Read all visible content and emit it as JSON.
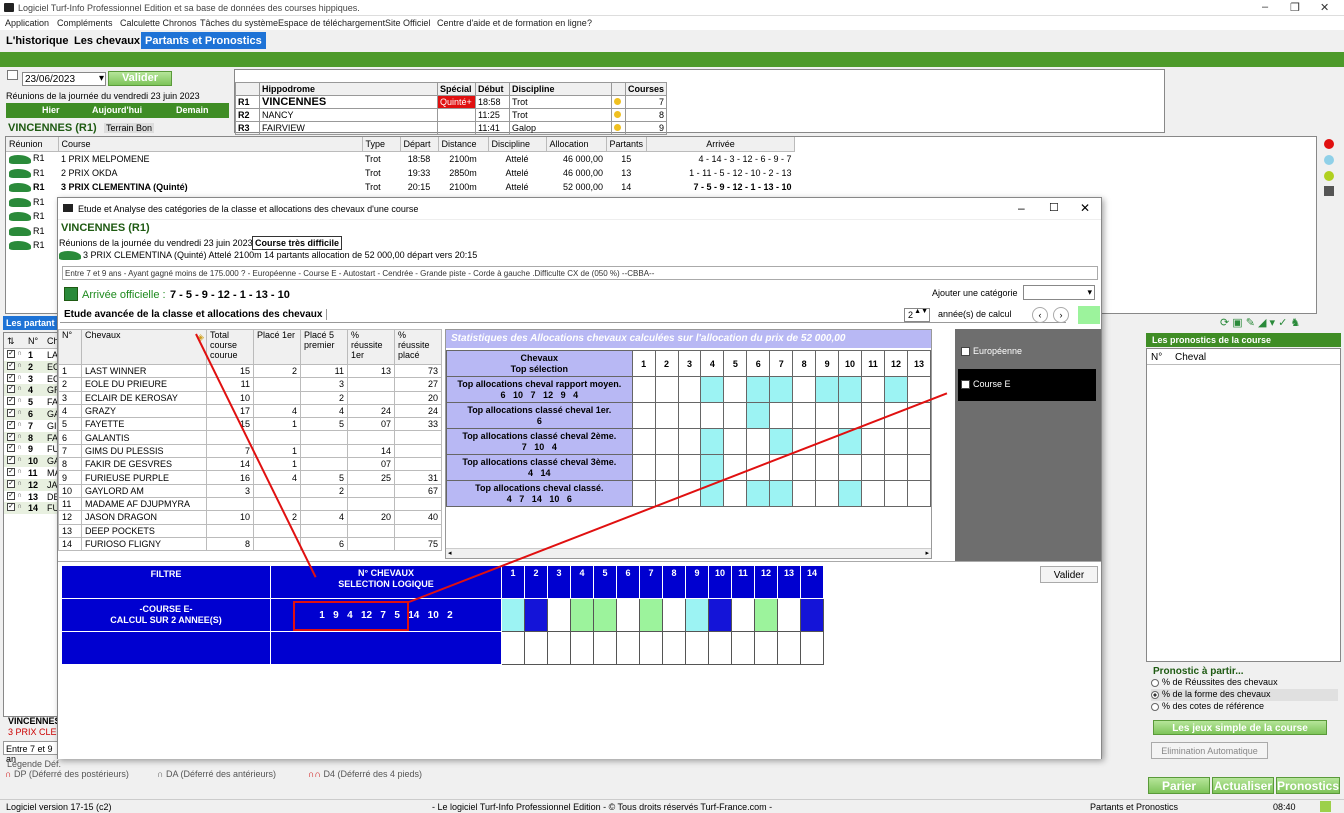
{
  "window": {
    "title": "Logiciel Turf-Info Professionnel Edition et sa base de données des courses hippiques."
  },
  "menu": [
    "Application",
    "Compléments",
    "Calculette Chronos",
    "Tâches du système",
    "Espace de téléchargement",
    "Site Officiel",
    "Centre d'aide et de formation en ligne",
    "?"
  ],
  "tabs": [
    "L'historique",
    "Les chevaux",
    "Partants et Pronostics"
  ],
  "date": {
    "value": "23/06/2023",
    "validate": "Valider",
    "reunions_label": "Réunions de la journée du vendredi 23 juin 2023",
    "hier": "Hier",
    "aujourdhui": "Aujourd'hui",
    "demain": "Demain"
  },
  "selected_reunion": {
    "name": "VINCENNES (R1)",
    "terrain": "Terrain Bon"
  },
  "hippodromes": {
    "headers": [
      "",
      "Hippodrome",
      "Spécial",
      "Début",
      "Discipline",
      "",
      "Courses"
    ],
    "rows": [
      {
        "r": "R1",
        "name": "VINCENNES",
        "special": "Quinté+",
        "debut": "18:58",
        "discipline": "Trot",
        "courses": "7"
      },
      {
        "r": "R2",
        "name": "NANCY",
        "special": "",
        "debut": "11:25",
        "discipline": "Trot",
        "courses": "8"
      },
      {
        "r": "R3",
        "name": "FAIRVIEW",
        "special": "",
        "debut": "11:41",
        "discipline": "Galop",
        "courses": "9"
      }
    ]
  },
  "races": {
    "headers": [
      "Réunion",
      "Course",
      "Type",
      "Départ",
      "Distance",
      "Discipline",
      "Allocation",
      "Partants",
      "Arrivée"
    ],
    "rows": [
      {
        "reunion": "R1",
        "course": "1 PRIX MELPOMENE",
        "type": "Trot",
        "depart": "18:58",
        "distance": "2100m",
        "discipline": "Attelé",
        "allocation": "46 000,00",
        "partants": "15",
        "arrivee": "4 - 14 - 3 - 12 - 6 - 9 - 7"
      },
      {
        "reunion": "R1",
        "course": "2 PRIX OKDA",
        "type": "Trot",
        "depart": "19:33",
        "distance": "2850m",
        "discipline": "Attelé",
        "allocation": "46 000,00",
        "partants": "13",
        "arrivee": "1 - 11 - 5 - 12 - 10 - 2 - 13"
      },
      {
        "reunion": "R1",
        "course": "3 PRIX CLEMENTINA (Quinté)",
        "type": "Trot",
        "depart": "20:15",
        "distance": "2100m",
        "discipline": "Attelé",
        "allocation": "52 000,00",
        "partants": "14",
        "arrivee": "7 - 5 - 9 - 12 - 1 - 13 - 10"
      },
      {
        "reunion": "R1"
      },
      {
        "reunion": "R1"
      },
      {
        "reunion": "R1"
      },
      {
        "reunion": "R1"
      }
    ]
  },
  "left_list": {
    "header_label": "Les partant",
    "cols": [
      "N°",
      "Ch"
    ],
    "rows": [
      {
        "n": "1",
        "c": "LA"
      },
      {
        "n": "2",
        "c": "EO"
      },
      {
        "n": "3",
        "c": "EC"
      },
      {
        "n": "4",
        "c": "GR"
      },
      {
        "n": "5",
        "c": "FA"
      },
      {
        "n": "6",
        "c": "GA"
      },
      {
        "n": "7",
        "c": "GI"
      },
      {
        "n": "8",
        "c": "FA"
      },
      {
        "n": "9",
        "c": "FU"
      },
      {
        "n": "10",
        "c": "GA"
      },
      {
        "n": "11",
        "c": "MA"
      },
      {
        "n": "12",
        "c": "JA"
      },
      {
        "n": "13",
        "c": "DE"
      },
      {
        "n": "14",
        "c": "FU"
      }
    ]
  },
  "bottom_left": {
    "reunion": "VINCENNES",
    "course": "3 PRIX CLEM",
    "cond": "Entre 7 et 9 an"
  },
  "legend": {
    "title": "Légende Déf.",
    "dp": "DP (Déferré des postérieurs)",
    "da": "DA (Déferré des antérieurs)",
    "d4": "D4 (Déferré des 4 pieds)"
  },
  "dialog": {
    "title": "Etude et Analyse des catégories de la classe et allocations des chevaux d'une course",
    "reunion": "VINCENNES (R1)",
    "reunions_label": "Réunions de la journée du vendredi 23 juin 2023",
    "difficulty": "Course très difficile",
    "race_line": "3 PRIX CLEMENTINA (Quinté) Attelé 2100m 14 partants allocation de 52 000,00 départ vers 20:15",
    "conditions": "Entre 7 et 9 ans  - Ayant gagné moins de 175.000 ? - Européenne  - Course E  - Autostart  - Cendrée  - Grande piste  - Corde à gauche .Difficulte CX de (050 %)  --CBBA--",
    "arrivee_label": "Arrivée officielle :",
    "arrivee_value": "7 - 5 - 9 - 12 - 1 - 13 - 10",
    "add_category": "Ajouter une catégorie",
    "section_title": "Etude avancée de la classe et allocations des chevaux",
    "years_value": "2",
    "years_label": "année(s) de calcul",
    "cat_headers": [
      "N°",
      "Chevaux",
      "Total course courue",
      "Placé 1er",
      "Placé 5 premier",
      "% réussite 1er",
      "% réussite placé"
    ],
    "cat_rows": [
      [
        "1",
        "LAST WINNER",
        "15",
        "2",
        "11",
        "13",
        "73"
      ],
      [
        "2",
        "EOLE DU PRIEURE",
        "11",
        "",
        "3",
        "",
        "27"
      ],
      [
        "3",
        "ECLAIR DE KEROSAY",
        "10",
        "",
        "2",
        "",
        "20"
      ],
      [
        "4",
        "GRAZY",
        "17",
        "4",
        "4",
        "24",
        "24"
      ],
      [
        "5",
        "FAYETTE",
        "15",
        "1",
        "5",
        "07",
        "33"
      ],
      [
        "6",
        "GALANTIS",
        "",
        "",
        "",
        "",
        ""
      ],
      [
        "7",
        "GIMS DU PLESSIS",
        "7",
        "1",
        "",
        "14",
        ""
      ],
      [
        "8",
        "FAKIR DE GESVRES",
        "14",
        "1",
        "",
        "07",
        ""
      ],
      [
        "9",
        "FURIEUSE PURPLE",
        "16",
        "4",
        "5",
        "25",
        "31"
      ],
      [
        "10",
        "GAYLORD AM",
        "3",
        "",
        "2",
        "",
        "67"
      ],
      [
        "11",
        "MADAME AF DJUPMYRA",
        "",
        "",
        "",
        "",
        ""
      ],
      [
        "12",
        "JASON DRAGON",
        "10",
        "2",
        "4",
        "20",
        "40"
      ],
      [
        "13",
        "DEEP POCKETS",
        "",
        "",
        "",
        "",
        ""
      ],
      [
        "14",
        "FURIOSO FLIGNY",
        "8",
        "",
        "6",
        "",
        "75"
      ]
    ],
    "stats_title": "Statistiques des Allocations chevaux calculées sur l'allocation du prix de 52 000,00",
    "stats_header": "Chevaux\nTop sélection",
    "stats_cols": [
      "1",
      "2",
      "3",
      "4",
      "5",
      "6",
      "7",
      "8",
      "9",
      "10",
      "11",
      "12",
      "13"
    ],
    "stats_rows": [
      {
        "label": "Top allocations cheval rapport moyen.",
        "values": "6   10   7   12   9   4",
        "cyan": [
          4,
          6,
          7,
          9,
          10,
          12
        ]
      },
      {
        "label": "Top allocations classé cheval 1er.",
        "values": "6",
        "cyan": [
          6
        ]
      },
      {
        "label": "Top allocations classé cheval 2ème.",
        "values": "7   10   4",
        "cyan": [
          4,
          7,
          10
        ]
      },
      {
        "label": "Top allocations classé cheval 3ème.",
        "values": "4   14",
        "cyan": [
          4
        ]
      },
      {
        "label": "Top allocations cheval classé.",
        "values": "4   7   14   10   6",
        "cyan": [
          4,
          6,
          7,
          10
        ]
      }
    ],
    "categories": [
      {
        "label": "Européenne",
        "checked": false
      },
      {
        "label": "Course E",
        "checked": true
      }
    ],
    "filter": {
      "col1": "FILTRE",
      "col2": "N° CHEVAUX\nSELECTION LOGIQUE",
      "nums": [
        "1",
        "2",
        "3",
        "4",
        "5",
        "6",
        "7",
        "8",
        "9",
        "10",
        "11",
        "12",
        "13",
        "14"
      ],
      "row_label": "-COURSE E-\nCALCUL SUR 2 ANNEE(S)",
      "selection": "1   9   4   12   7   5   14   10   2",
      "colors": [
        "cyan",
        "b",
        "w",
        "gr",
        "gr",
        "w",
        "gr",
        "w",
        "cyan",
        "b",
        "w",
        "gr",
        "w",
        "b"
      ]
    },
    "validate": "Valider"
  },
  "right": {
    "title": "Les pronostics de la course",
    "cols": [
      "N°",
      "Cheval"
    ],
    "pronostic_title": "Pronostic à partir...",
    "options": [
      {
        "label": "% de Réussites des chevaux",
        "on": false
      },
      {
        "label": "% de la forme des chevaux",
        "on": true
      },
      {
        "label": "% des cotes de référence",
        "on": false
      }
    ],
    "jeux": "Les jeux simple de la course",
    "elimination": "Elimination Automatique",
    "parier": "Parier",
    "actualiser": "Actualiser",
    "pronostics": "Pronostics"
  },
  "status": {
    "version": "Logiciel version 17-15 (c2)",
    "copyright": "- Le logiciel Turf-Info Professionnel Edition - © Tous droits réservés Turf-France.com -",
    "section": "Partants et Pronostics",
    "time": "08:40"
  }
}
